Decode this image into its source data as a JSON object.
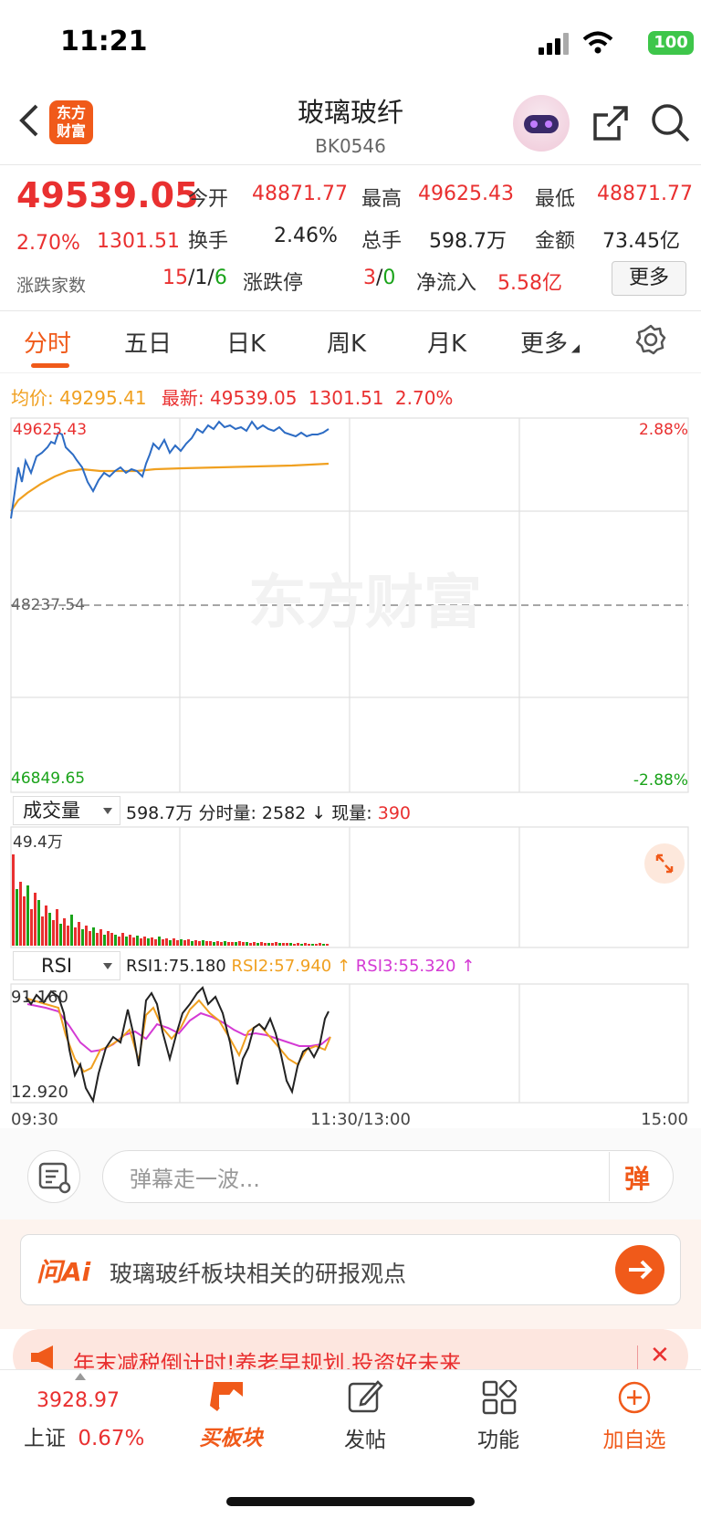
{
  "status": {
    "time": "11:21",
    "battery": "100"
  },
  "header": {
    "title": "玻璃玻纤",
    "code": "BK0546",
    "logo_line1": "东方",
    "logo_line2": "财富"
  },
  "quote": {
    "price": "49539.05",
    "change_pct": "2.70%",
    "change": "1301.51",
    "open_label": "今开",
    "open": "48871.77",
    "high_label": "最高",
    "high": "49625.43",
    "low_label": "最低",
    "low": "48871.77",
    "turnover_label": "换手",
    "turnover": "2.46%",
    "volume_label": "总手",
    "volume": "598.7万",
    "amount_label": "金额",
    "amount": "73.45亿",
    "breadth_label": "涨跌家数",
    "breadth_up": "15",
    "breadth_flat": "1",
    "breadth_down": "6",
    "slash": "/",
    "limit_label": "涨跌停",
    "limit_up": "3",
    "limit_down": "0",
    "netflow_label": "净流入",
    "netflow": "5.58亿",
    "more": "更多"
  },
  "tabs": [
    "分时",
    "五日",
    "日K",
    "周K",
    "月K",
    "更多"
  ],
  "avg": {
    "avg_label": "均价:",
    "avg_value": "49295.41",
    "latest_label": "最新:",
    "latest_value": "49539.05",
    "change": "1301.51",
    "pct": "2.70%"
  },
  "price_chart": {
    "y_top": "49625.43",
    "y_mid": "48237.54",
    "y_bottom": "46849.65",
    "pct_top": "2.88%",
    "pct_bottom": "-2.88%",
    "watermark": "东方财富"
  },
  "volume_panel": {
    "selector": "成交量",
    "total": "598.7万",
    "minute_label": "分时量:",
    "minute_value": "2582 ↓",
    "now_label": "现量:",
    "now_value": "390",
    "max_label": "49.4万"
  },
  "rsi_panel": {
    "selector": "RSI",
    "rsi1": "RSI1:75.180",
    "rsi2": "RSI2:57.940 ↑",
    "rsi3": "RSI3:55.320 ↑",
    "y_top": "91.160",
    "y_bottom": "12.920"
  },
  "time_axis": {
    "start": "09:30",
    "mid": "11:30/13:00",
    "end": "15:00"
  },
  "danmu": {
    "placeholder": "弹幕走一波...",
    "button": "弹"
  },
  "ai": {
    "logo": "问Ai",
    "text": "玻璃玻纤板块相关的研报观点"
  },
  "ad": {
    "text": "年末减税倒计时!养老早规划,投资好未来"
  },
  "nav": {
    "index_value": "3928.97",
    "index_name": "上证",
    "index_pct": "0.67%",
    "buy": "买板块",
    "post": "发帖",
    "func": "功能",
    "add": "加自选"
  },
  "colors": {
    "accent": "#f05a1a",
    "up": "#e93030",
    "down": "#1aa31a",
    "price_line": "#2d6cc4",
    "avg_line": "#f0a020"
  }
}
